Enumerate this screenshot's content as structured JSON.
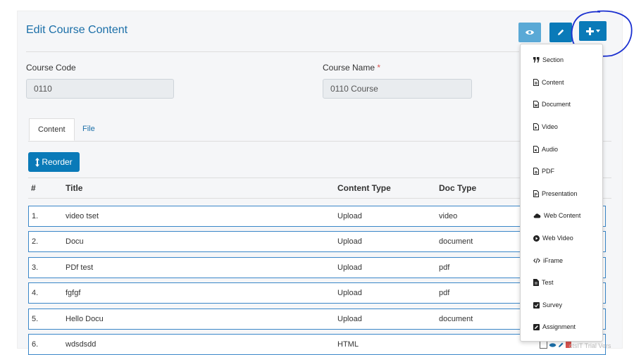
{
  "page": {
    "title": "Edit Course Content"
  },
  "header_buttons": {
    "view_icon": "eye-icon",
    "edit_icon": "pencil-icon",
    "add_icon": "plus-icon",
    "add_caret_icon": "caret-down-icon"
  },
  "form": {
    "course_code": {
      "label": "Course Code",
      "value": "0110"
    },
    "course_name": {
      "label": "Course Name",
      "required_mark": "*",
      "value": "0110 Course"
    }
  },
  "tabs": [
    {
      "label": "Content",
      "active": true
    },
    {
      "label": "File",
      "active": false
    }
  ],
  "reorder_button": {
    "label": "Reorder",
    "icon": "vertical-arrows-icon"
  },
  "table": {
    "columns": [
      "#",
      "Title",
      "Content Type",
      "Doc Type"
    ],
    "rows": [
      {
        "num": "1.",
        "title": "video tset",
        "content_type": "Upload",
        "doc_type": "video"
      },
      {
        "num": "2.",
        "title": "Docu",
        "content_type": "Upload",
        "doc_type": "document"
      },
      {
        "num": "3.",
        "title": "PDf test",
        "content_type": "Upload",
        "doc_type": "pdf"
      },
      {
        "num": "4.",
        "title": "fgfgf",
        "content_type": "Upload",
        "doc_type": "pdf"
      },
      {
        "num": "5.",
        "title": "Hello Docu",
        "content_type": "Upload",
        "doc_type": "document"
      },
      {
        "num": "6.",
        "title": "wdsdsdd",
        "content_type": "HTML",
        "doc_type": ""
      }
    ]
  },
  "add_menu": {
    "items": [
      {
        "label": "Section",
        "icon": "quote-icon"
      },
      {
        "label": "Content",
        "icon": "file-text-icon"
      },
      {
        "label": "Document",
        "icon": "file-word-icon"
      },
      {
        "label": "Video",
        "icon": "file-video-icon"
      },
      {
        "label": "Audio",
        "icon": "file-audio-icon"
      },
      {
        "label": "PDF",
        "icon": "file-pdf-icon"
      },
      {
        "label": "Presentation",
        "icon": "file-powerpoint-icon"
      },
      {
        "label": "Web Content",
        "icon": "cloud-icon"
      },
      {
        "label": "Web Video",
        "icon": "play-circle-icon"
      },
      {
        "label": "iFrame",
        "icon": "code-icon"
      },
      {
        "label": "Test",
        "icon": "file-icon"
      },
      {
        "label": "Survey",
        "icon": "check-square-icon"
      },
      {
        "label": "Assignment",
        "icon": "edit-square-icon"
      }
    ]
  },
  "watermark": {
    "text": "ctsIT Trial Vers"
  },
  "colors": {
    "primary": "#0a7ab8",
    "light_primary": "#5aa9d6",
    "title_blue": "#1b6fa8",
    "row_border": "#3a86c8",
    "annotation_ring": "#1a2fd0"
  }
}
